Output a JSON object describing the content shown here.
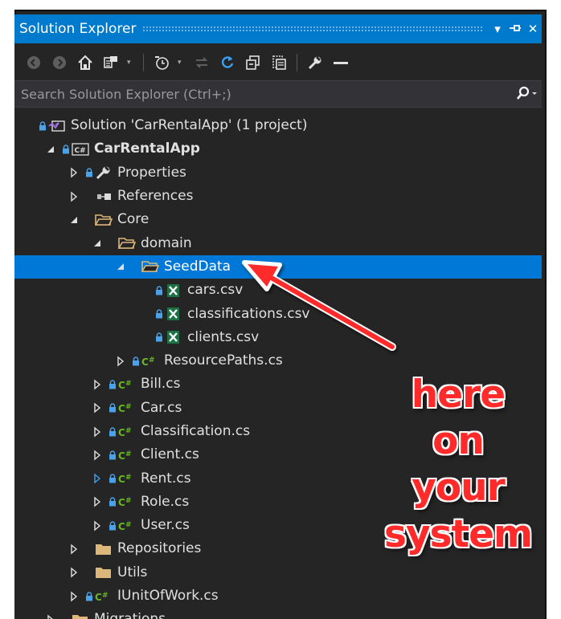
{
  "window": {
    "title": "Solution Explorer",
    "dropdown_glyph": "▾",
    "pin_glyph": "⊣",
    "close_glyph": "✕"
  },
  "search": {
    "placeholder": "Search Solution Explorer (Ctrl+;)"
  },
  "tree": [
    {
      "label": "Solution 'CarRentalApp' (1 project)",
      "level": 0,
      "expander": "none",
      "icon": "solution-icon",
      "locked": true
    },
    {
      "label": "CarRentalApp",
      "level": 1,
      "expander": "expanded",
      "icon": "csharp-project-icon",
      "locked": true,
      "bold": true
    },
    {
      "label": "Properties",
      "level": 2,
      "expander": "collapsed",
      "icon": "wrench-icon",
      "locked": true
    },
    {
      "label": "References",
      "level": 2,
      "expander": "collapsed",
      "icon": "references-icon",
      "locked": false
    },
    {
      "label": "Core",
      "level": 2,
      "expander": "expanded",
      "icon": "folder-open-icon",
      "locked": false
    },
    {
      "label": "domain",
      "level": 3,
      "expander": "expanded",
      "icon": "folder-open-icon",
      "locked": false
    },
    {
      "label": "SeedData",
      "level": 4,
      "expander": "expanded",
      "icon": "folder-open-icon",
      "locked": false,
      "selected": true
    },
    {
      "label": "cars.csv",
      "level": 5,
      "expander": "none",
      "icon": "excel-icon",
      "locked": true
    },
    {
      "label": "classifications.csv",
      "level": 5,
      "expander": "none",
      "icon": "excel-icon",
      "locked": true
    },
    {
      "label": "clients.csv",
      "level": 5,
      "expander": "none",
      "icon": "excel-icon",
      "locked": true
    },
    {
      "label": "ResourcePaths.cs",
      "level": 4,
      "expander": "collapsed",
      "icon": "csharp-file-icon",
      "locked": true
    },
    {
      "label": "Bill.cs",
      "level": 3,
      "expander": "collapsed",
      "icon": "csharp-file-icon",
      "locked": true
    },
    {
      "label": "Car.cs",
      "level": 3,
      "expander": "collapsed",
      "icon": "csharp-file-icon",
      "locked": true
    },
    {
      "label": "Classification.cs",
      "level": 3,
      "expander": "collapsed",
      "icon": "csharp-file-icon",
      "locked": true
    },
    {
      "label": "Client.cs",
      "level": 3,
      "expander": "collapsed",
      "icon": "csharp-file-icon",
      "locked": true
    },
    {
      "label": "Rent.cs",
      "level": 3,
      "expander": "collapsed-blue",
      "icon": "csharp-file-icon",
      "locked": true
    },
    {
      "label": "Role.cs",
      "level": 3,
      "expander": "collapsed",
      "icon": "csharp-file-icon",
      "locked": true
    },
    {
      "label": "User.cs",
      "level": 3,
      "expander": "collapsed",
      "icon": "csharp-file-icon",
      "locked": true
    },
    {
      "label": "Repositories",
      "level": 2,
      "expander": "collapsed",
      "icon": "folder-icon",
      "locked": false
    },
    {
      "label": "Utils",
      "level": 2,
      "expander": "collapsed",
      "icon": "folder-icon",
      "locked": false
    },
    {
      "label": "IUnitOfWork.cs",
      "level": 2,
      "expander": "collapsed",
      "icon": "csharp-file-icon",
      "locked": true
    },
    {
      "label": "Migrations",
      "level": 1,
      "expander": "collapsed",
      "icon": "folder-icon",
      "locked": false
    }
  ],
  "annotation": {
    "lines": [
      "here",
      "on",
      "your",
      "system"
    ],
    "color": "#ff2a2a"
  },
  "colors": {
    "accent": "#007acc",
    "selection": "#0078d7",
    "panel": "#252526",
    "csharp": "#68b723",
    "excel": "#1e7145"
  }
}
